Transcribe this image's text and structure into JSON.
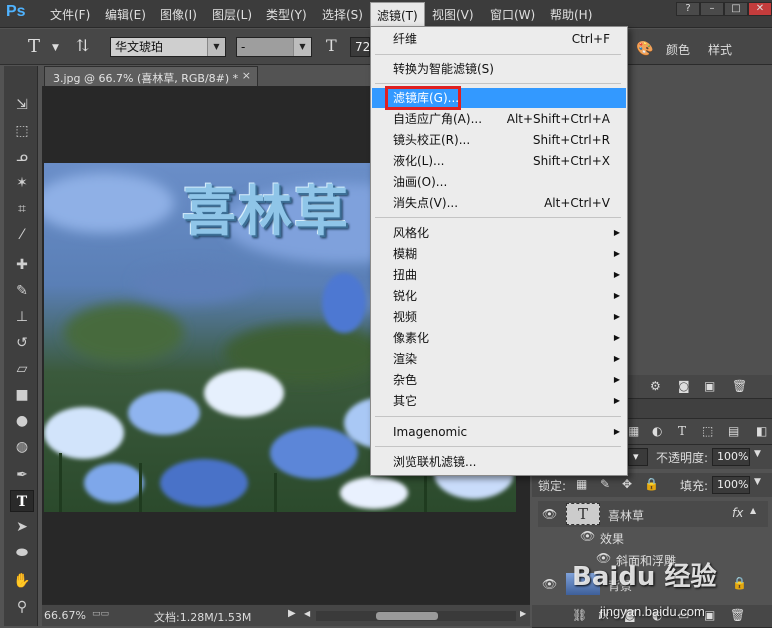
{
  "app": {
    "logo": "Ps"
  },
  "menubar": {
    "items": [
      "文件(F)",
      "编辑(E)",
      "图像(I)",
      "图层(L)",
      "类型(Y)",
      "选择(S)",
      "滤镜(T)",
      "视图(V)",
      "窗口(W)",
      "帮助(H)"
    ],
    "active_index": 6
  },
  "window_controls": {
    "help": "?",
    "minimize": "–",
    "maximize": "□",
    "close": "✕"
  },
  "options": {
    "font_family": "华文琥珀",
    "font_style": "-",
    "font_size": "72"
  },
  "panel_top": {
    "color_tab": "颜色",
    "style_tab": "样式"
  },
  "document": {
    "tab_title": "3.jpg @ 66.7% (喜林草, RGB/8#) *",
    "tab_close": "×",
    "canvas_text": "喜林草"
  },
  "status": {
    "zoom": "66.67%",
    "doc_info": "文档:1.28M/1.53M"
  },
  "filter_menu": {
    "items": [
      {
        "label": "纤维",
        "shortcut": "Ctrl+F"
      },
      {
        "label": "转换为智能滤镜(S)"
      },
      {
        "label": "滤镜库(G)...",
        "highlighted": true
      },
      {
        "label": "自适应广角(A)...",
        "shortcut": "Alt+Shift+Ctrl+A"
      },
      {
        "label": "镜头校正(R)...",
        "shortcut": "Shift+Ctrl+R"
      },
      {
        "label": "液化(L)...",
        "shortcut": "Shift+Ctrl+X"
      },
      {
        "label": "油画(O)..."
      },
      {
        "label": "消失点(V)...",
        "shortcut": "Alt+Ctrl+V"
      },
      {
        "label": "风格化",
        "submenu": true
      },
      {
        "label": "模糊",
        "submenu": true
      },
      {
        "label": "扭曲",
        "submenu": true
      },
      {
        "label": "锐化",
        "submenu": true
      },
      {
        "label": "视频",
        "submenu": true
      },
      {
        "label": "像素化",
        "submenu": true
      },
      {
        "label": "渲染",
        "submenu": true
      },
      {
        "label": "杂色",
        "submenu": true
      },
      {
        "label": "其它",
        "submenu": true
      },
      {
        "label": "Imagenomic",
        "submenu": true
      },
      {
        "label": "浏览联机滤镜..."
      }
    ]
  },
  "layers": {
    "opacity_label": "不透明度:",
    "opacity_value": "100%",
    "lock_label": "锁定:",
    "fill_label": "填充:",
    "fill_value": "100%",
    "text_layer_name": "喜林草",
    "effects_label": "效果",
    "bevel_label": "斜面和浮雕",
    "bg_layer_name": "背景",
    "fx_label": "fx"
  },
  "watermark": {
    "text": "Baidu 经验",
    "url": "jingyan.baidu.com"
  },
  "colors": {
    "accent": "#3399ff",
    "red_box": "#e02020"
  }
}
